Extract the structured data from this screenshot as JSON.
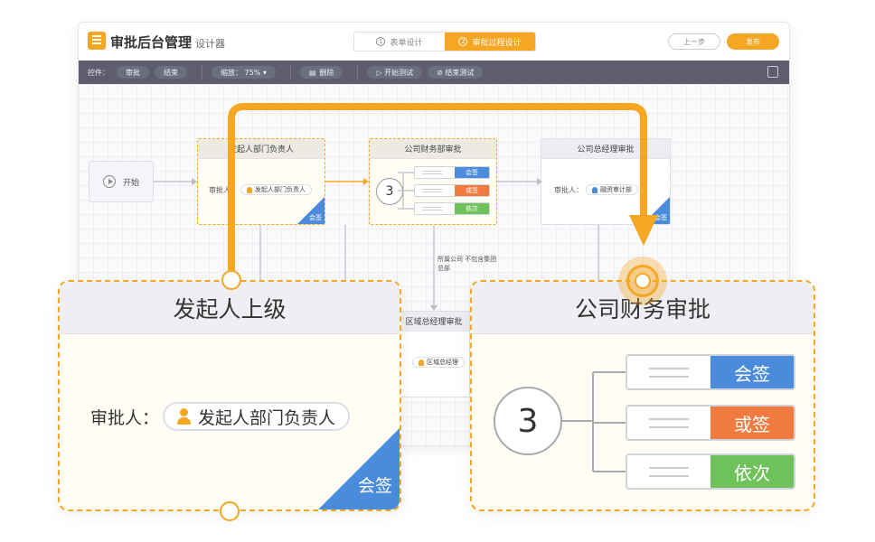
{
  "app": {
    "title": "审批后台管理",
    "subtitle": "设计器",
    "steps": [
      {
        "num": "①",
        "label": "表单设计"
      },
      {
        "num": "②",
        "label": "审批过程设计"
      }
    ],
    "prev_label": "上一步",
    "publish_label": "发布"
  },
  "toolbar": {
    "controls_label": "控件：",
    "approve_label": "审批",
    "end_label": "结束",
    "zoom_label": "缩放： 75% ▾",
    "delete_label": "删除",
    "start_test_label": "▷ 开始测试",
    "end_test_label": "⊘ 结束测试"
  },
  "flow": {
    "start_label": "开始",
    "node_initiator": {
      "title": "发起人部门负责人",
      "approver_prefix": "审批人：",
      "approver": "发起人部门负责人",
      "mode": "会签"
    },
    "node_finance": {
      "title": "公司财务部审批",
      "count": "3",
      "options": [
        "会签",
        "或签",
        "依次"
      ]
    },
    "node_gm": {
      "title": "公司总经理审批",
      "approver_prefix": "审批人：",
      "approver": "融资审计部",
      "mode": "会签"
    },
    "edge_condition": [
      "所属公司 不包含集团",
      "总部"
    ],
    "node_region": {
      "title": "区域总经理审批",
      "approver": "区域总经理"
    }
  },
  "zoom_left": {
    "title": "发起人上级",
    "approver_prefix": "审批人：",
    "approver": "发起人部门负责人",
    "mode": "会签"
  },
  "zoom_right": {
    "title": "公司财务审批",
    "count": "3",
    "options": [
      "会签",
      "或签",
      "依次"
    ]
  },
  "colors": {
    "accent": "#f5a623",
    "countersign": "#4a8bdb",
    "or_sign": "#f07a3f",
    "sequential": "#6fc25a"
  }
}
